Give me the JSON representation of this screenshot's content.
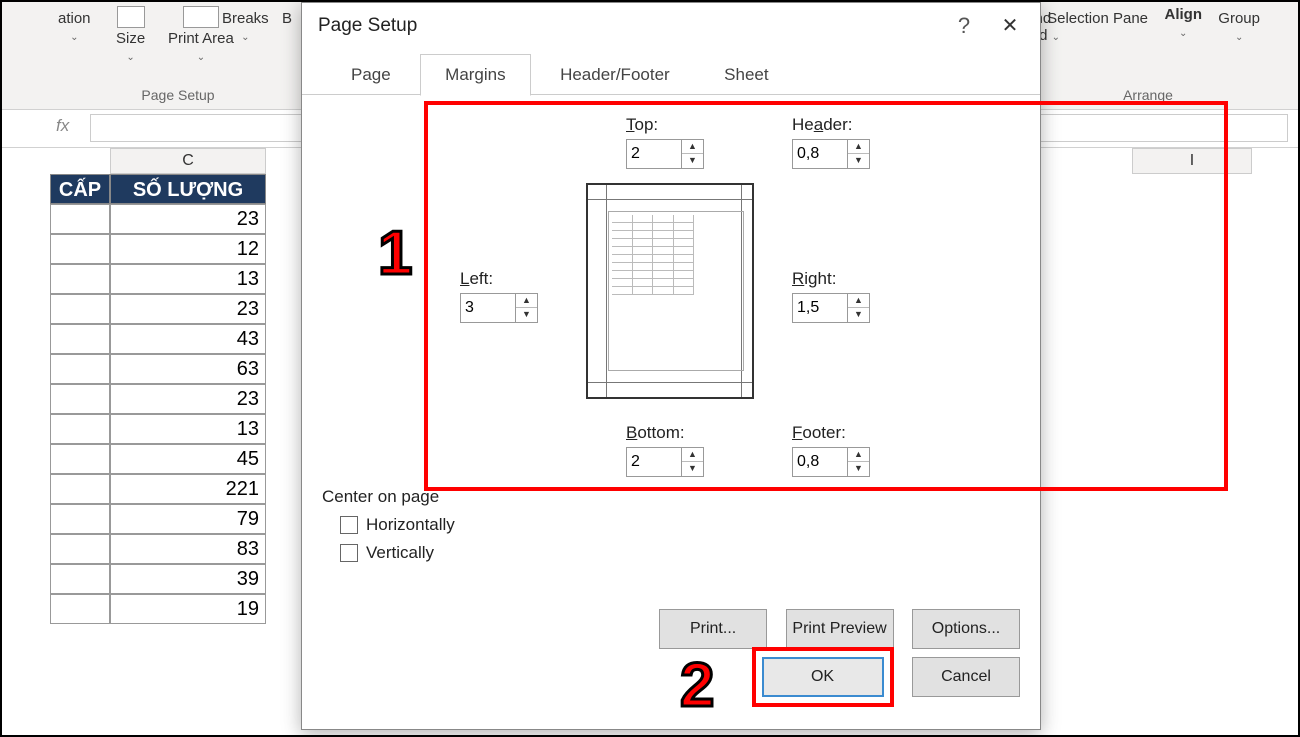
{
  "ribbon": {
    "items": [
      "ation",
      "Size",
      "Print Area",
      "Breaks",
      "B"
    ],
    "right_items": [
      "nd",
      "ard",
      "Selection Pane",
      "Align",
      "Group"
    ],
    "group_left": "Page Setup",
    "group_right": "Arrange"
  },
  "sheet": {
    "col_c": "C",
    "col_i": "I",
    "header_b": "CẤP",
    "header_c": "SỐ LƯỢNG",
    "values": [
      "23",
      "12",
      "13",
      "23",
      "43",
      "63",
      "23",
      "13",
      "45",
      "221",
      "79",
      "83",
      "39",
      "19"
    ]
  },
  "dialog": {
    "title": "Page Setup",
    "tabs": [
      "Page",
      "Margins",
      "Header/Footer",
      "Sheet"
    ],
    "active_tab": 1,
    "fields": {
      "top": {
        "label": "Top:",
        "value": "2"
      },
      "header": {
        "label": "Header:",
        "value": "0,8"
      },
      "left": {
        "label": "Left:",
        "value": "3"
      },
      "right": {
        "label": "Right:",
        "value": "1,5"
      },
      "bottom": {
        "label": "Bottom:",
        "value": "2"
      },
      "footer": {
        "label": "Footer:",
        "value": "0,8"
      }
    },
    "center_label": "Center on page",
    "center_h": "Horizontally",
    "center_v": "Vertically",
    "buttons": {
      "print": "Print...",
      "preview": "Print Preview",
      "options": "Options...",
      "ok": "OK",
      "cancel": "Cancel"
    }
  },
  "annotations": {
    "one": "1",
    "two": "2"
  }
}
